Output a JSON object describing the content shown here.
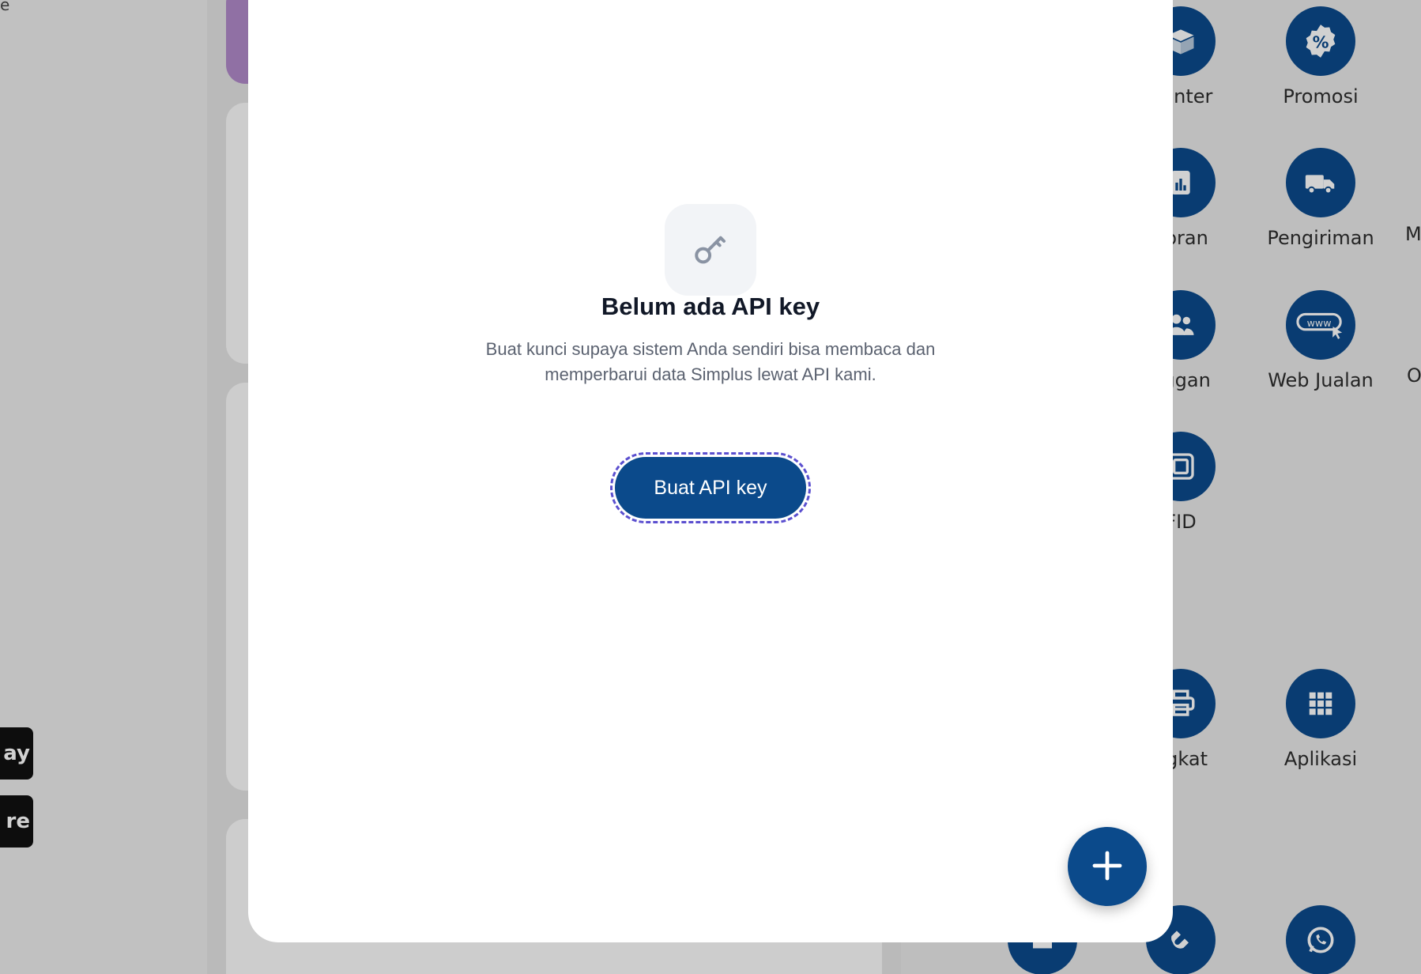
{
  "background": {
    "left_text": "e",
    "badges": [
      "ay",
      "re"
    ],
    "tiles": [
      {
        "label": "Center",
        "icon": "box-icon"
      },
      {
        "label": "Promosi",
        "icon": "percent-badge-icon"
      },
      {
        "label": "poran",
        "icon": "report-chart-icon"
      },
      {
        "label": "Pengiriman",
        "icon": "truck-icon"
      },
      {
        "label": "nggan",
        "icon": "customers-icon"
      },
      {
        "label": "Web Jualan",
        "icon": "www-cursor-icon"
      },
      {
        "label": "FID",
        "icon": "rfid-icon"
      },
      {
        "label": "ngkat",
        "icon": "printer-icon"
      },
      {
        "label": "Aplikasi",
        "icon": "grid-apps-icon"
      }
    ],
    "edge_labels": [
      "M",
      "O"
    ]
  },
  "modal": {
    "empty_state": {
      "icon": "key-icon",
      "title": "Belum ada API key",
      "description": "Buat kunci supaya sistem Anda sendiri bisa membaca dan memperbarui data Simplus lewat API kami.",
      "button_label": "Buat API key"
    },
    "fab_icon": "plus-icon"
  },
  "colors": {
    "primary": "#0b4a8b",
    "focus_ring": "#5b4fcf",
    "icon_bg": "#f2f4f7",
    "title": "#111827",
    "description": "#5b6270"
  }
}
